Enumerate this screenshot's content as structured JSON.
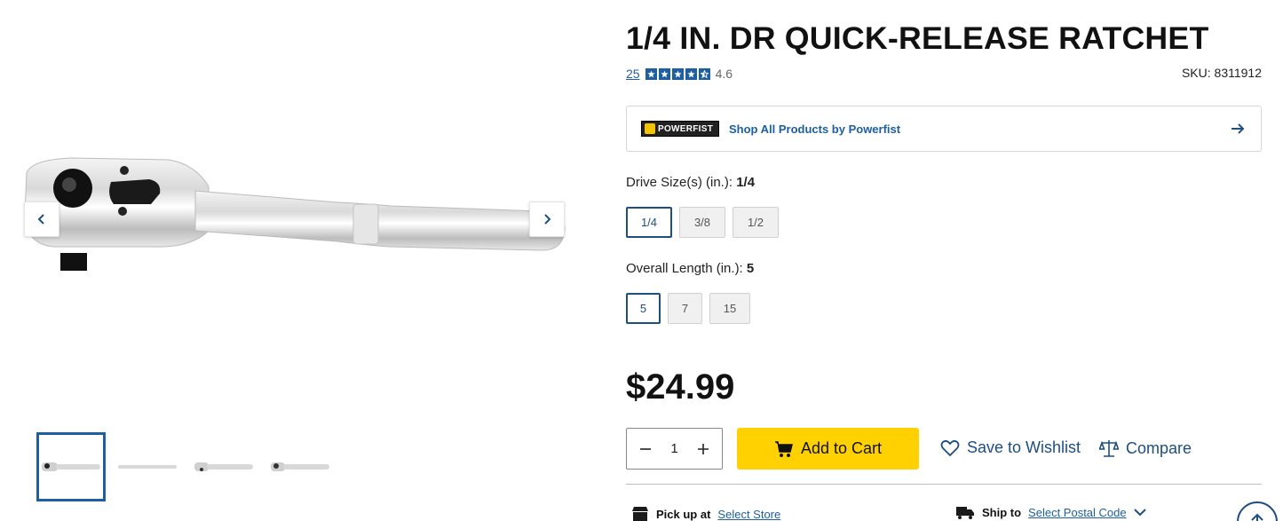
{
  "product": {
    "title": "1/4 IN. DR QUICK-RELEASE RATCHET",
    "review_count": "25",
    "rating": "4.6",
    "rating_fraction": 0.92,
    "sku": "SKU: 8311912",
    "price": "$24.99"
  },
  "brand": {
    "logo_text": "POWERFIST",
    "link": "Shop All Products by Powerfist"
  },
  "options": {
    "drive": {
      "label": "Drive Size(s) (in.):",
      "selected": "1/4",
      "values": [
        "1/4",
        "3/8",
        "1/2"
      ]
    },
    "length": {
      "label": "Overall Length (in.):",
      "selected": "5",
      "values": [
        "5",
        "7",
        "15"
      ]
    }
  },
  "cart": {
    "quantity": "1",
    "add_label": "Add to Cart",
    "wishlist_label": "Save to Wishlist",
    "compare_label": "Compare"
  },
  "fulfilment": {
    "pickup_label": "Pick up at",
    "pickup_link": "Select Store",
    "ship_label": "Ship to",
    "ship_link": "Select Postal Code"
  },
  "gallery": {
    "thumb_count": 4,
    "active_index": 0
  },
  "colors": {
    "accent": "#1d5fa0",
    "cta": "#ffd100",
    "selected_option": "#1d4f80"
  },
  "icons": [
    "chevron-left-icon",
    "chevron-right-icon",
    "arrow-right-icon",
    "minus-icon",
    "plus-icon",
    "cart-icon",
    "heart-icon",
    "scale-icon",
    "store-icon",
    "truck-icon",
    "chevron-down-icon",
    "arrow-up-icon"
  ]
}
